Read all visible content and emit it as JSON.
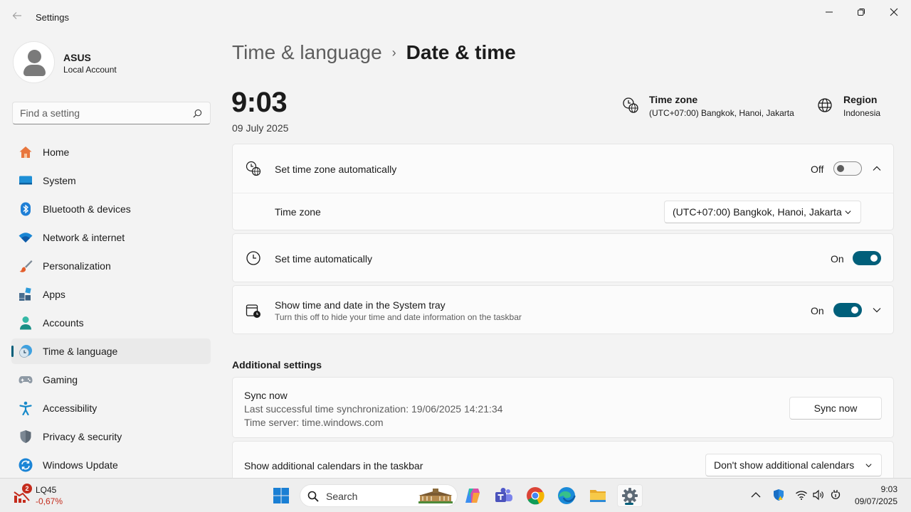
{
  "window": {
    "title": "Settings"
  },
  "user": {
    "name": "ASUS",
    "account_type": "Local Account"
  },
  "search": {
    "placeholder": "Find a setting"
  },
  "sidebar": {
    "items": [
      {
        "label": "Home",
        "icon": "home-icon"
      },
      {
        "label": "System",
        "icon": "system-icon"
      },
      {
        "label": "Bluetooth & devices",
        "icon": "bluetooth-icon"
      },
      {
        "label": "Network & internet",
        "icon": "wifi-icon"
      },
      {
        "label": "Personalization",
        "icon": "brush-icon"
      },
      {
        "label": "Apps",
        "icon": "apps-icon"
      },
      {
        "label": "Accounts",
        "icon": "accounts-icon"
      },
      {
        "label": "Time & language",
        "icon": "time-language-icon",
        "active": true
      },
      {
        "label": "Gaming",
        "icon": "gamepad-icon"
      },
      {
        "label": "Accessibility",
        "icon": "accessibility-icon"
      },
      {
        "label": "Privacy & security",
        "icon": "shield-icon"
      },
      {
        "label": "Windows Update",
        "icon": "update-icon"
      }
    ]
  },
  "breadcrumb": {
    "parent": "Time & language",
    "separator": "›",
    "current": "Date & time"
  },
  "clock": {
    "time": "9:03",
    "date": "09 July 2025"
  },
  "header_info": {
    "timezone_title": "Time zone",
    "timezone_value": "(UTC+07:00) Bangkok, Hanoi, Jakarta",
    "region_title": "Region",
    "region_value": "Indonesia"
  },
  "settings": {
    "tz_auto": {
      "title": "Set time zone automatically",
      "state": "Off",
      "enabled": false
    },
    "time_zone": {
      "label": "Time zone",
      "selected": "(UTC+07:00) Bangkok, Hanoi, Jakarta"
    },
    "time_auto": {
      "title": "Set time automatically",
      "state": "On",
      "enabled": true
    },
    "tray": {
      "title": "Show time and date in the System tray",
      "subtitle": "Turn this off to hide your time and date information on the taskbar",
      "state": "On",
      "enabled": true
    }
  },
  "additional": {
    "title": "Additional settings",
    "sync_title": "Sync now",
    "last_sync": "Last successful time synchronization: 19/06/2025 14:21:34",
    "server": "Time server: time.windows.com",
    "sync_button": "Sync now",
    "calendars_label": "Show additional calendars in the taskbar",
    "calendars_selected": "Don't show additional calendars"
  },
  "taskbar": {
    "stock_badge": "2",
    "stock_ticker": "LQ45",
    "stock_change": "-0,67%",
    "search_label": "Search",
    "apps": [
      "windows-start-icon",
      "copilot-icon",
      "teams-icon",
      "chrome-icon",
      "edge-icon",
      "file-explorer-icon",
      "settings-icon"
    ],
    "time": "9:03",
    "date": "09/07/2025"
  },
  "colors": {
    "accent": "#005f7a",
    "background": "#f3f3f3",
    "card": "#fbfbfb",
    "negative": "#c42b1c"
  }
}
